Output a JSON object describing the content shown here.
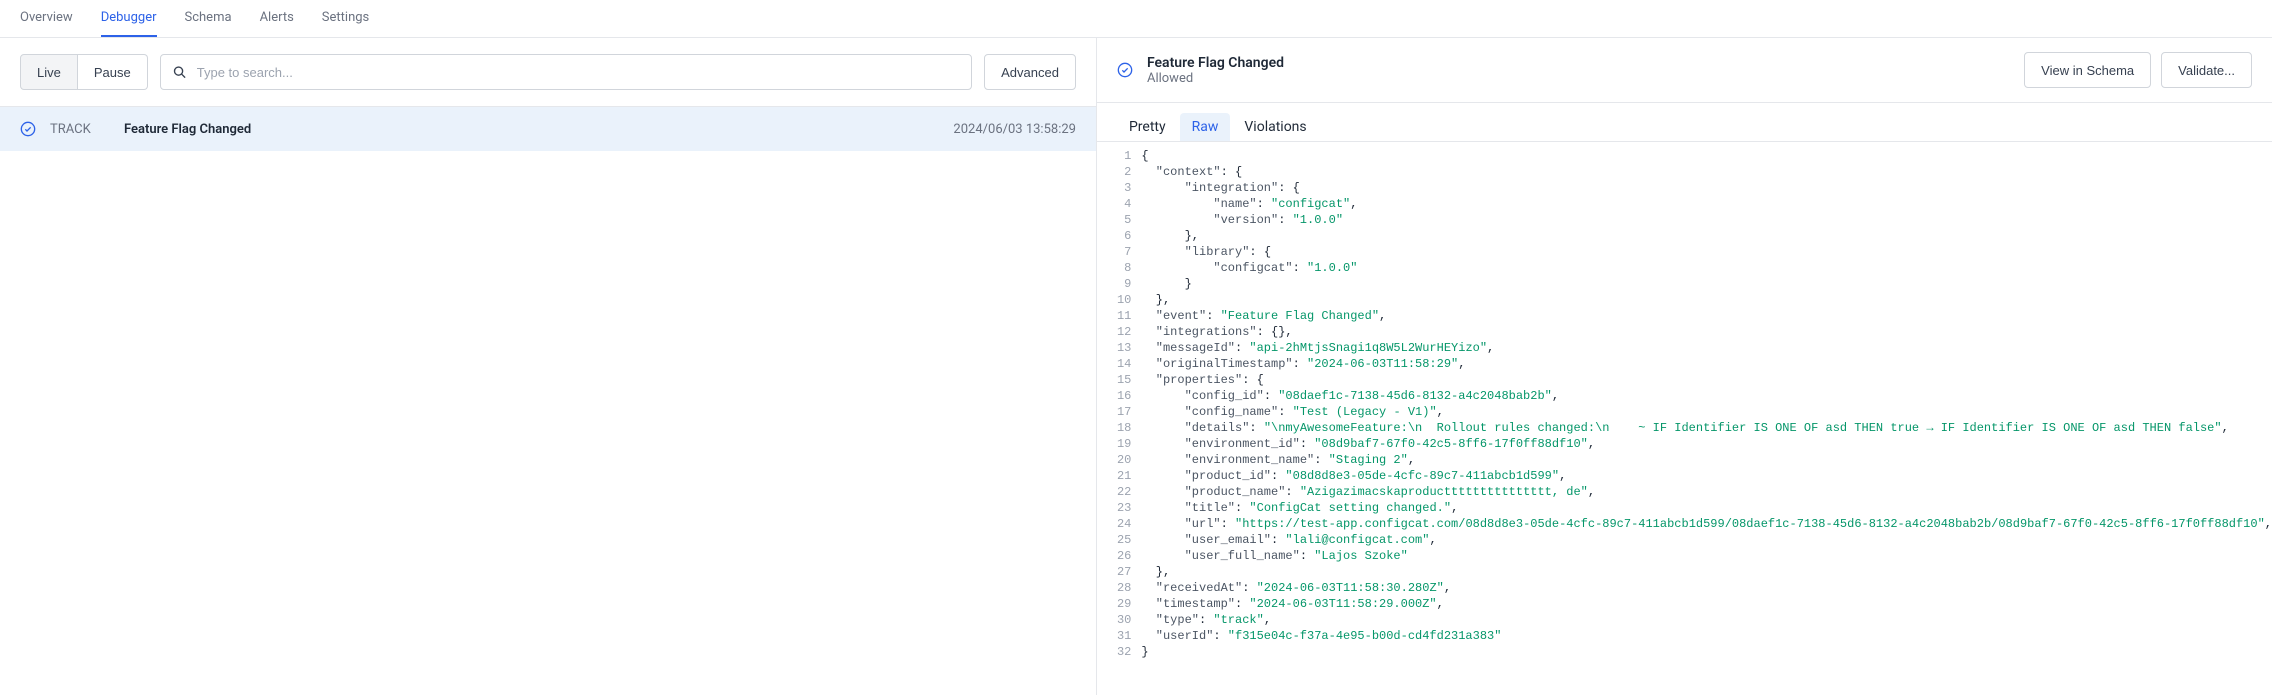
{
  "nav": {
    "tabs": [
      "Overview",
      "Debugger",
      "Schema",
      "Alerts",
      "Settings"
    ],
    "active": "Debugger"
  },
  "toolbar": {
    "live": "Live",
    "pause": "Pause",
    "search_placeholder": "Type to search...",
    "advanced": "Advanced"
  },
  "event": {
    "type": "TRACK",
    "name": "Feature Flag Changed",
    "timestamp": "2024/06/03 13:58:29"
  },
  "detail": {
    "title": "Feature Flag Changed",
    "status": "Allowed",
    "view_in_schema": "View in Schema",
    "validate": "Validate..."
  },
  "subtabs": {
    "pretty": "Pretty",
    "raw": "Raw",
    "violations": "Violations",
    "active": "Raw"
  },
  "raw_payload": {
    "context": {
      "integration": {
        "name": "configcat",
        "version": "1.0.0"
      },
      "library": {
        "configcat": "1.0.0"
      }
    },
    "event": "Feature Flag Changed",
    "integrations": {},
    "messageId": "api-2hMtjsSnagi1q8W5L2WurHEYizo",
    "originalTimestamp": "2024-06-03T11:58:29",
    "properties": {
      "config_id": "08daef1c-7138-45d6-8132-a4c2048bab2b",
      "config_name": "Test (Legacy - V1)",
      "details": "\\nmyAwesomeFeature:\\n  Rollout rules changed:\\n    ~ IF Identifier IS ONE OF asd THEN true → IF Identifier IS ONE OF asd THEN false",
      "environment_id": "08d9baf7-67f0-42c5-8ff6-17f0ff88df10",
      "environment_name": "Staging 2",
      "product_id": "08d8d8e3-05de-4cfc-89c7-411abcb1d599",
      "product_name": "Azigazimacskaproducttttttttttttttt, de",
      "title": "ConfigCat setting changed.",
      "url": "https://test-app.configcat.com/08d8d8e3-05de-4cfc-89c7-411abcb1d599/08daef1c-7138-45d6-8132-a4c2048bab2b/08d9baf7-67f0-42c5-8ff6-17f0ff88df10",
      "user_email": "lali@configcat.com",
      "user_full_name": "Lajos Szoke"
    },
    "receivedAt": "2024-06-03T11:58:30.280Z",
    "timestamp": "2024-06-03T11:58:29.000Z",
    "type": "track",
    "userId": "f315e04c-f37a-4e95-b00d-cd4fd231a383"
  }
}
